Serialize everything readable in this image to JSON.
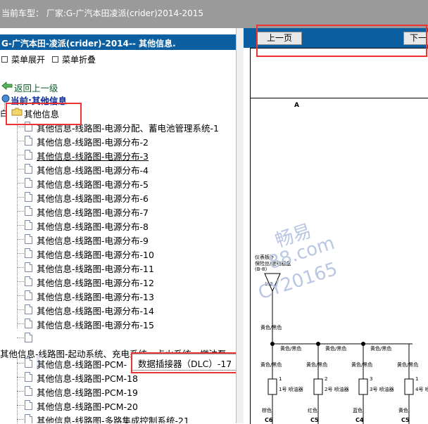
{
  "topbar": {
    "label": "当前车型： 厂家:G-广汽本田凌派(crider)2014-2015"
  },
  "left": {
    "header": "G-广汽本田-凌派(crider)-2014-- 其他信息.",
    "expand": "菜单展开",
    "collapse": "菜单折叠",
    "back": "返回上一级",
    "current": "当前:其他信息",
    "folder": "其他信息",
    "items": [
      "其他信息-线路图-电源分配、蓄电池管理系统-1",
      "其他信息-线路图-电源分布-2",
      "其他信息-线路图-电源分布-3",
      "其他信息-线路图-电源分布-4",
      "其他信息-线路图-电源分布-5",
      "其他信息-线路图-电源分布-6",
      "其他信息-线路图-电源分布-7",
      "其他信息-线路图-电源分布-8",
      "其他信息-线路图-电源分布-9",
      "其他信息-线路图-电源分布-10",
      "其他信息-线路图-电源分布-11",
      "其他信息-线路图-电源分布-12",
      "其他信息-线路图-电源分布-13",
      "其他信息-线路图-电源分布-14",
      "其他信息-线路图-电源分布-15",
      ""
    ],
    "group2": "其他信息-线路图-起动系统、充电系统、点火系统、燃油泵",
    "items2": [
      "其他信息-线路图-PCM-",
      "其他信息-线路图-PCM-18",
      "其他信息-线路图-PCM-19",
      "其他信息-线路图-PCM-20",
      "其他信息-线路图-多路集成控制系统-21"
    ],
    "popup": "数据插接器（DLC）-17"
  },
  "right": {
    "prev": "上一页",
    "next": "下一",
    "diagram": {
      "label_a": "A",
      "fuse_label1": "仪表板下",
      "fuse_label2": "保险丝/继电器盒",
      "fuse_label3": "(B-8)",
      "fuse_num": "15B",
      "wire": "黄色/黑色",
      "injectors": [
        "1号 喷油器",
        "2号 喷油器",
        "3号 喷油器",
        "4号 喷油器"
      ],
      "pins": [
        "1",
        "2",
        "3",
        "1"
      ],
      "bottom": [
        "棕色",
        "红色",
        "蓝色",
        "黄色"
      ],
      "codes": [
        "C6",
        "C5",
        "C4",
        "C5"
      ]
    },
    "watermark": [
      "畅易",
      "88.com",
      "CY20165"
    ]
  }
}
